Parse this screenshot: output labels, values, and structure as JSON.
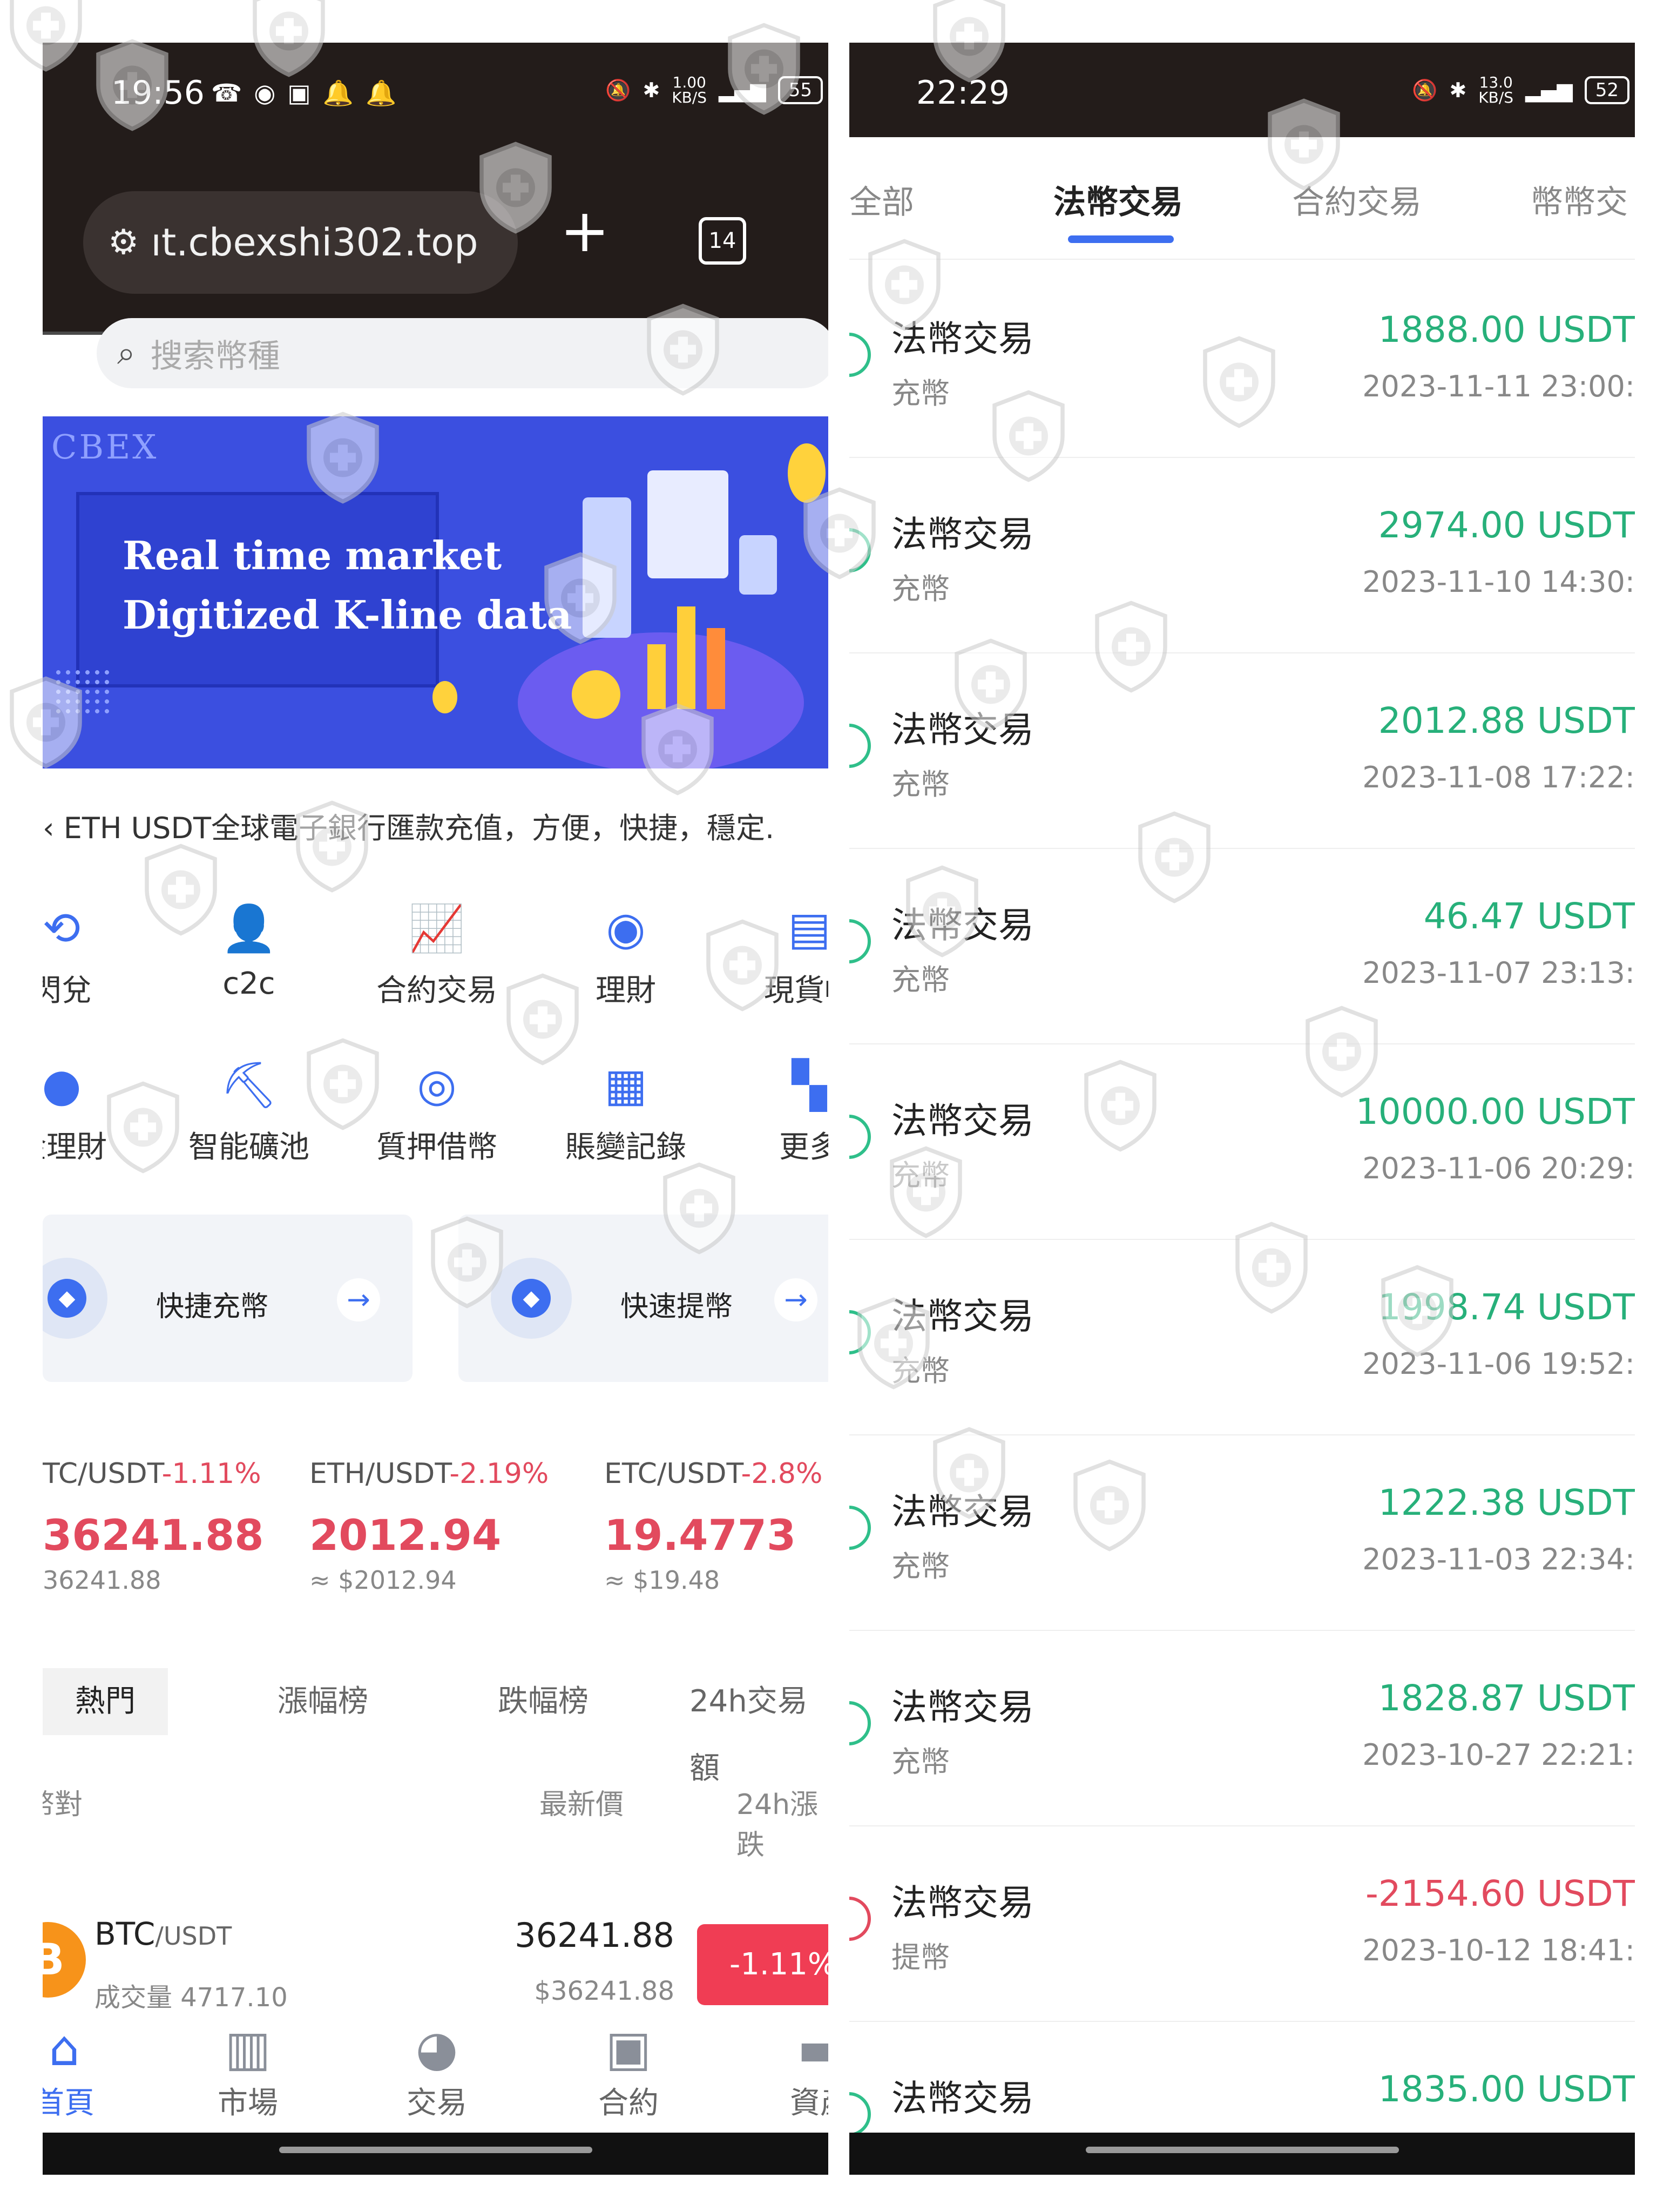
{
  "left_screen": {
    "status": {
      "time": "19:56",
      "netspeed_value": "1.00",
      "netspeed_unit": "KB/S",
      "battery": "55"
    },
    "browser": {
      "url": "ıt.cbexshi302.top",
      "tab_count": "14",
      "new_tab_glyph": "+"
    },
    "search": {
      "placeholder": "搜索幣種"
    },
    "banner": {
      "logo": "CBEX",
      "line1": "Real time market",
      "line2": "Digitized K-line data"
    },
    "marquee": "ETH USDT全球電子銀行匯款充值，方便，快捷，穩定.",
    "grid_row1": [
      {
        "label": "閃兌",
        "icon": "exchange-icon"
      },
      {
        "label": "c2c",
        "icon": "user-add-icon"
      },
      {
        "label": "合約交易",
        "icon": "chart-up-icon"
      },
      {
        "label": "理財",
        "icon": "piggy-bank-icon"
      },
      {
        "label": "現貨帳",
        "icon": "ledger-icon"
      }
    ],
    "grid_row2": [
      {
        "label": "金理財",
        "icon": "coin-icon"
      },
      {
        "label": "智能礦池",
        "icon": "pickaxe-icon"
      },
      {
        "label": "質押借幣",
        "icon": "target-icon"
      },
      {
        "label": "賬變記錄",
        "icon": "records-icon"
      },
      {
        "label": "更多",
        "icon": "more-icon"
      }
    ],
    "quick_cards": [
      {
        "label": "快捷充幣"
      },
      {
        "label": "快速提幣"
      }
    ],
    "tickers": [
      {
        "pair": "TC/USDT",
        "change": "-1.11%",
        "price": "36241.88",
        "approx": "36241.88"
      },
      {
        "pair": "ETH/USDT",
        "change": "-2.19%",
        "price": "2012.94",
        "approx": "≈ $2012.94"
      },
      {
        "pair": "ETC/USDT",
        "change": "-2.8%",
        "price": "19.4773",
        "approx": "≈ $19.48"
      }
    ],
    "market_tabs": [
      "熱門",
      "漲幅榜",
      "跌幅榜",
      "24h交易額"
    ],
    "columns": {
      "pair": "幣對",
      "latest": "最新價",
      "change": "24h漲跌"
    },
    "market_row": {
      "base": "BTC",
      "quote": "/USDT",
      "volume": "成交量 4717.10",
      "price": "36241.88",
      "usd": "$36241.88",
      "change": "-1.11%"
    },
    "bottom_nav": [
      {
        "label": "首頁",
        "icon": "home-icon"
      },
      {
        "label": "市場",
        "icon": "bar-chart-icon"
      },
      {
        "label": "交易",
        "icon": "trade-icon"
      },
      {
        "label": "合約",
        "icon": "contract-icon"
      },
      {
        "label": "資產",
        "icon": "wallet-icon"
      }
    ]
  },
  "right_screen": {
    "status": {
      "time": "22:29",
      "netspeed_value": "13.0",
      "netspeed_unit": "KB/S",
      "battery": "52"
    },
    "tabs": [
      "全部",
      "法幣交易",
      "合約交易",
      "幣幣交"
    ],
    "active_tab": "法幣交易",
    "transactions": [
      {
        "title": "法幣交易",
        "type": "充幣",
        "amount": "1888.00 USDT",
        "time": "2023-11-11 23:00:"
      },
      {
        "title": "法幣交易",
        "type": "充幣",
        "amount": "2974.00 USDT",
        "time": "2023-11-10 14:30:"
      },
      {
        "title": "法幣交易",
        "type": "充幣",
        "amount": "2012.88 USDT",
        "time": "2023-11-08 17:22:"
      },
      {
        "title": "法幣交易",
        "type": "充幣",
        "amount": "46.47 USDT",
        "time": "2023-11-07 23:13:"
      },
      {
        "title": "法幣交易",
        "type": "充幣",
        "amount": "10000.00 USDT",
        "time": "2023-11-06 20:29:"
      },
      {
        "title": "法幣交易",
        "type": "充幣",
        "amount": "1998.74 USDT",
        "time": "2023-11-06 19:52:"
      },
      {
        "title": "法幣交易",
        "type": "充幣",
        "amount": "1222.38 USDT",
        "time": "2023-11-03 22:34:"
      },
      {
        "title": "法幣交易",
        "type": "充幣",
        "amount": "1828.87 USDT",
        "time": "2023-10-27 22:21:"
      },
      {
        "title": "法幣交易",
        "type": "提幣",
        "amount": "-2154.60 USDT",
        "time": "2023-10-12 18:41:"
      },
      {
        "title": "法幣交易",
        "type": "",
        "amount": "1835.00 USDT",
        "time": ""
      }
    ]
  },
  "colors": {
    "accent": "#3d6ef0",
    "up": "#27b07a",
    "down": "#e24a5e",
    "statusbar": "#231c1a"
  }
}
